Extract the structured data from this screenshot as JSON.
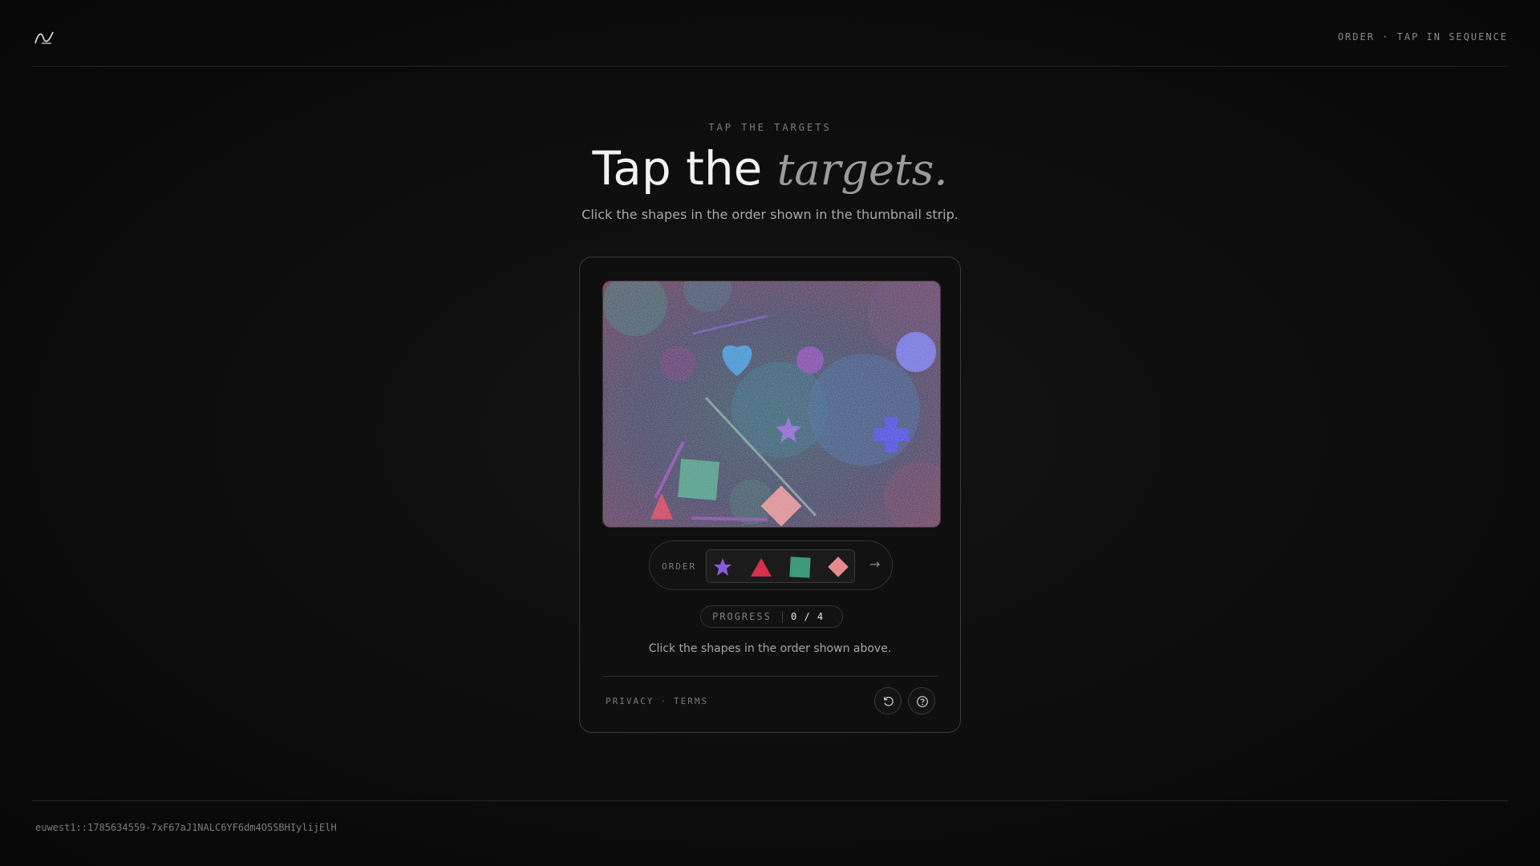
{
  "header": {
    "mode_label": "ORDER · TAP IN SEQUENCE"
  },
  "hero": {
    "eyebrow": "TAP THE TARGETS",
    "title_main": "Tap the ",
    "title_emphasis": "targets.",
    "subtitle": "Click the shapes in the order shown in the thumbnail strip."
  },
  "challenge": {
    "order_label": "ORDER",
    "order_sequence": [
      {
        "shape": "star",
        "color": "#8a5bd6"
      },
      {
        "shape": "triangle",
        "color": "#d4314a"
      },
      {
        "shape": "square",
        "color": "#3f9a7c"
      },
      {
        "shape": "diamond",
        "color": "#e68a8c"
      }
    ],
    "next_arrow": "→",
    "progress_label": "PROGRESS",
    "progress_value": "0 / 4",
    "instruction": "Click the shapes in the order shown above."
  },
  "footer": {
    "privacy": "PRIVACY",
    "separator": "·",
    "terms": "TERMS",
    "reload_icon": "reload-icon",
    "help_icon": "help-icon"
  },
  "session_id": "euwest1::1785634559-7xF67aJ1NALC6YF6dm4O5SBHIylijElH",
  "colors": {
    "background": "#0b0b0b",
    "card_border": "#3a3a3a",
    "heart": "#2f8fd6",
    "target_star": "#8a5bd6",
    "target_triangle": "#d4314a",
    "target_square": "#3f9a7c",
    "target_diamond": "#e68a8c",
    "cross": "#3d3de6",
    "circle_large": "#6a6ae6"
  }
}
